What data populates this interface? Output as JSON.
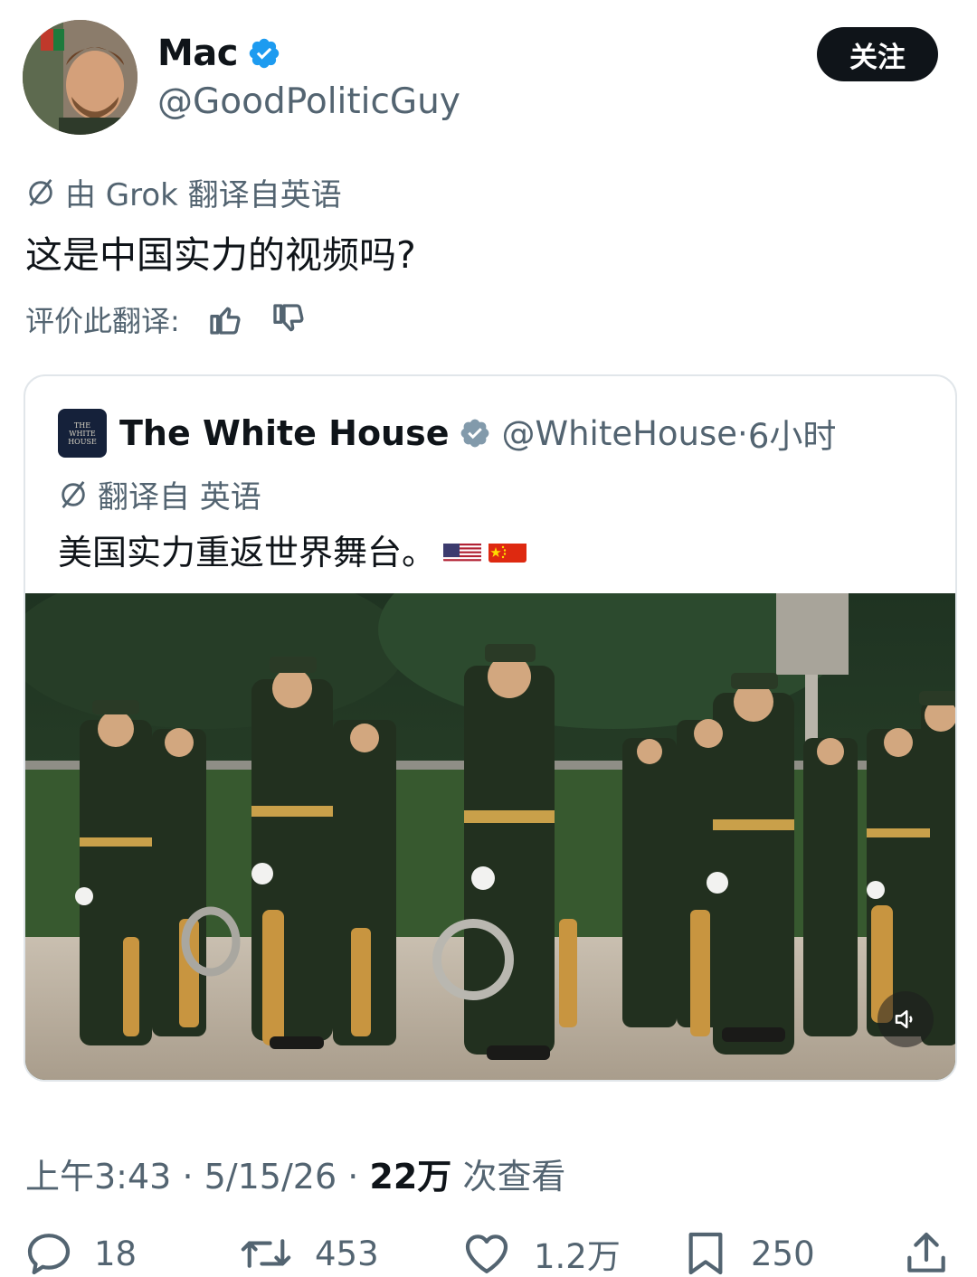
{
  "author": {
    "display_name": "Mac",
    "handle": "@GoodPoliticGuy",
    "follow_label": "关注"
  },
  "translation": {
    "note": "由 Grok 翻译自英语",
    "text": "这是中国实力的视频吗?",
    "rate_label": "评价此翻译:"
  },
  "quoted_tweet": {
    "logo_text": [
      "THE",
      "WHITE",
      "HOUSE"
    ],
    "display_name": "The White House",
    "handle": "@WhiteHouse",
    "separator": "·",
    "time": "6小时",
    "translate_note": "翻译自 英语",
    "text": "美国实力重返世界舞台。",
    "flags": [
      "us-flag",
      "cn-flag"
    ]
  },
  "meta": {
    "time": "上午3:43",
    "date": "5/15/26",
    "views_count": "22万",
    "views_label": "次查看",
    "separator": "·"
  },
  "actions": {
    "replies": "18",
    "retweets": "453",
    "likes": "1.2万",
    "bookmarks": "250"
  },
  "colors": {
    "verified": "#1d9bf0",
    "text": "#0f1419",
    "secondary": "#536471"
  }
}
